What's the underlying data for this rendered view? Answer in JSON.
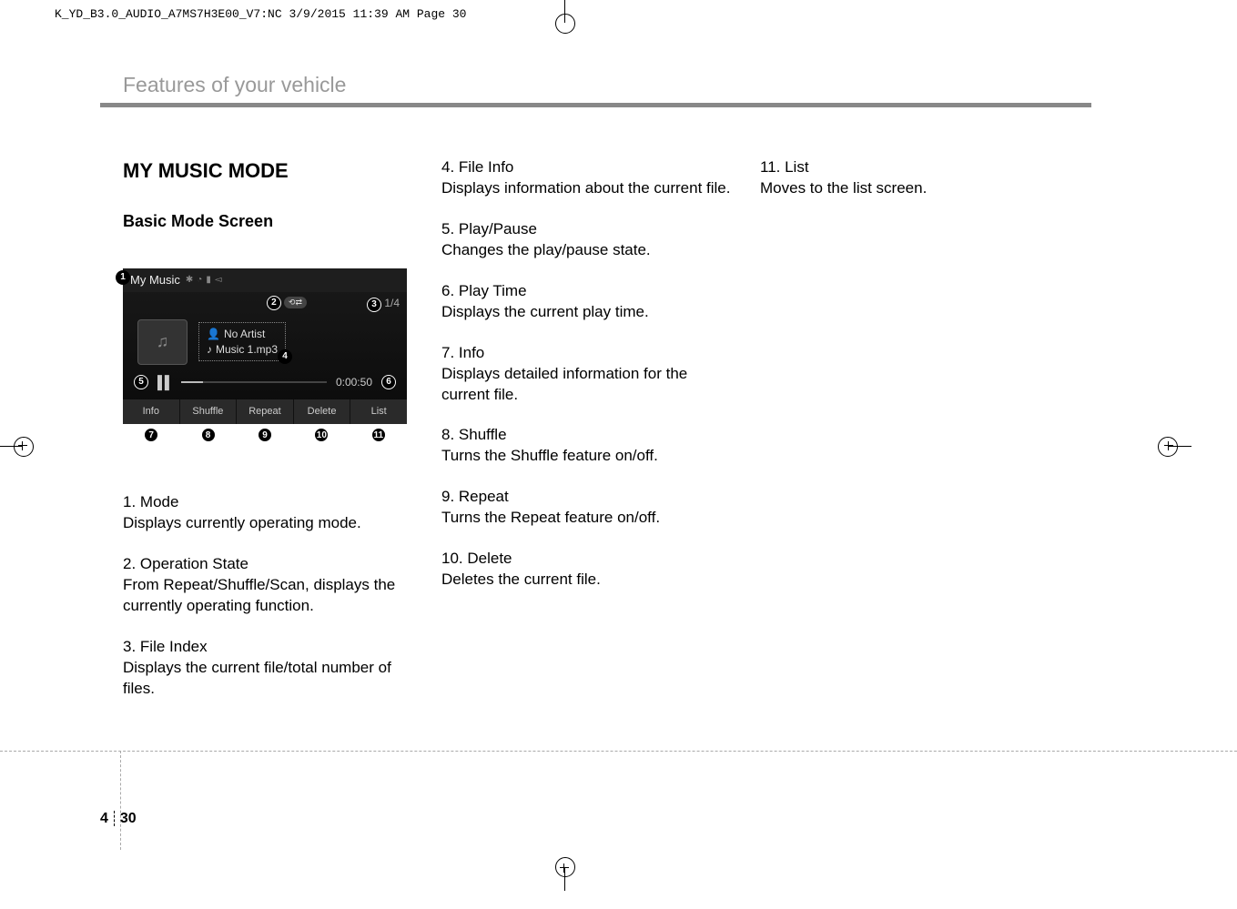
{
  "crop_header": "K_YD_B3.0_AUDIO_A7MS7H3E00_V7:NC  3/9/2015  11:39 AM  Page 30",
  "section_header": "Features of your vehicle",
  "title_main": "MY MUSIC MODE",
  "title_sub": "Basic Mode Screen",
  "device": {
    "mode_label": "My Music",
    "artist": "No Artist",
    "filename": "Music 1.mp3",
    "index": "1/4",
    "time": "0:00:50",
    "buttons": [
      "Info",
      "Shuffle",
      "Repeat",
      "Delete",
      "List"
    ],
    "callouts_top": [
      "1",
      "2",
      "3",
      "4",
      "5",
      "6"
    ],
    "callouts_bottom": [
      "7",
      "8",
      "9",
      "10",
      "11"
    ]
  },
  "items_col1": [
    {
      "num": "1.",
      "name": "Mode",
      "desc": "Displays currently operating mode."
    },
    {
      "num": "2.",
      "name": "Operation State",
      "desc": "From Repeat/Shuffle/Scan, displays the currently operating function."
    },
    {
      "num": "3.",
      "name": "File Index",
      "desc": "Displays the current file/total number of files."
    }
  ],
  "items_col2": [
    {
      "num": "4.",
      "name": "File Info",
      "desc": "Displays information about the current file.",
      "justify": true
    },
    {
      "num": "5.",
      "name": "Play/Pause",
      "desc": "Changes the play/pause state."
    },
    {
      "num": "6.",
      "name": "Play Time",
      "desc": "Displays the current play time."
    },
    {
      "num": "7.",
      "name": "Info",
      "desc": "Displays detailed information for the current file."
    },
    {
      "num": "8.",
      "name": "Shuffle",
      "desc": "Turns the Shuffle feature on/off."
    },
    {
      "num": "9.",
      "name": "Repeat",
      "desc": "Turns the Repeat feature on/off."
    },
    {
      "num": "10.",
      "name": "Delete",
      "desc": "Deletes the current file."
    }
  ],
  "items_col3": [
    {
      "num": "11.",
      "name": "List",
      "desc": "Moves to the list screen."
    }
  ],
  "page_num": {
    "chapter": "4",
    "page": "30"
  }
}
